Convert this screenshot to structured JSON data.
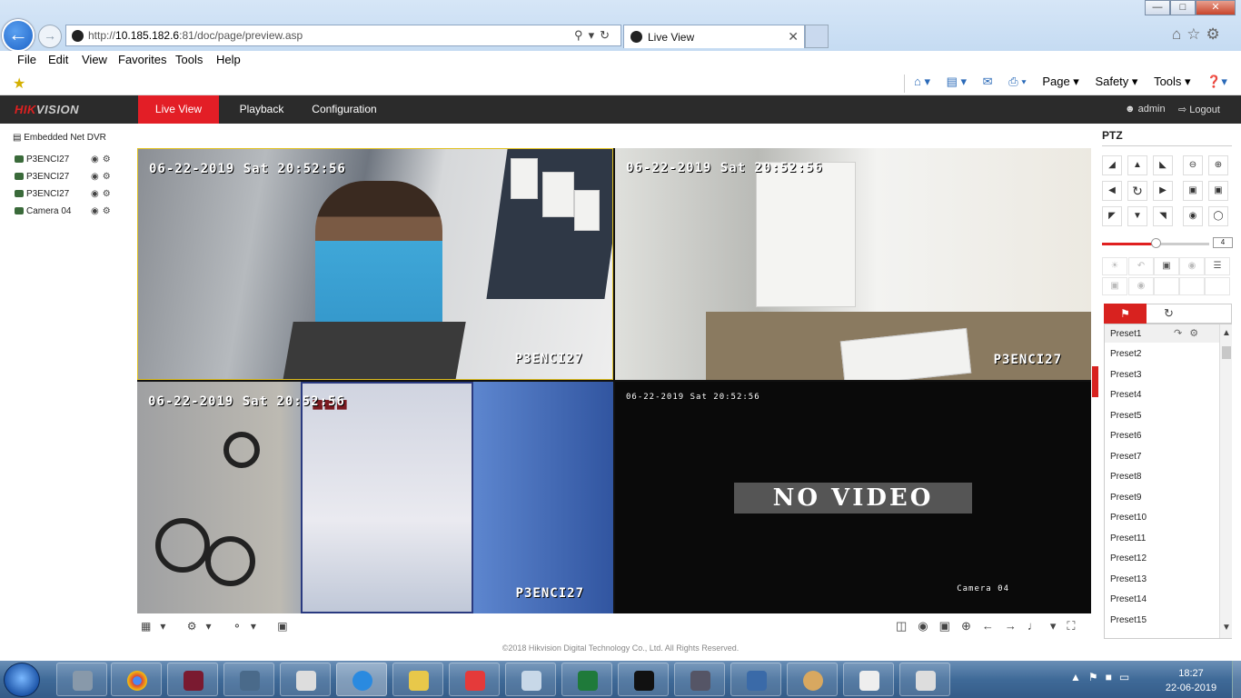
{
  "browser": {
    "url_prefix": "http://",
    "url_host": "10.185.182.6",
    "url_rest": ":81/doc/page/preview.asp",
    "tab_title": "Live View",
    "menu": [
      "File",
      "Edit",
      "View",
      "Favorites",
      "Tools",
      "Help"
    ],
    "command_bar": [
      "Page ▾",
      "Safety ▾",
      "Tools ▾"
    ]
  },
  "app": {
    "logo_red": "HIK",
    "logo_grey": "VISION",
    "nav": [
      "Live View",
      "Playback",
      "Configuration"
    ],
    "user": "admin",
    "logout": "Logout",
    "accent_color": "#e31e26"
  },
  "tree": {
    "root": "Embedded Net DVR",
    "cameras": [
      "P3ENCI27",
      "P3ENCI27",
      "P3ENCI27",
      "Camera 04"
    ]
  },
  "video": {
    "windows": [
      {
        "timestamp": "06-22-2019 Sat 20:52:56",
        "name": "P3ENCI27"
      },
      {
        "timestamp": "06-22-2019 Sat 20:52:56",
        "name": "P3ENCI27"
      },
      {
        "timestamp": "06-22-2019 Sat 20:52:56",
        "name": "P3ENCI27"
      },
      {
        "timestamp": "06-22-2019 Sat 20:52:56",
        "name": "Camera 04",
        "overlay": "NO VIDEO"
      }
    ]
  },
  "footer": {
    "copyright": "©2018 Hikvision Digital Technology Co., Ltd. All Rights Reserved."
  },
  "ptz": {
    "title": "PTZ",
    "speed": "4",
    "speed_fraction": 0.5,
    "presets": [
      "Preset1",
      "Preset2",
      "Preset3",
      "Preset4",
      "Preset5",
      "Preset6",
      "Preset7",
      "Preset8",
      "Preset9",
      "Preset10",
      "Preset11",
      "Preset12",
      "Preset13",
      "Preset14",
      "Preset15"
    ]
  },
  "taskbar": {
    "time": "18:27",
    "date": "22-06-2019"
  }
}
